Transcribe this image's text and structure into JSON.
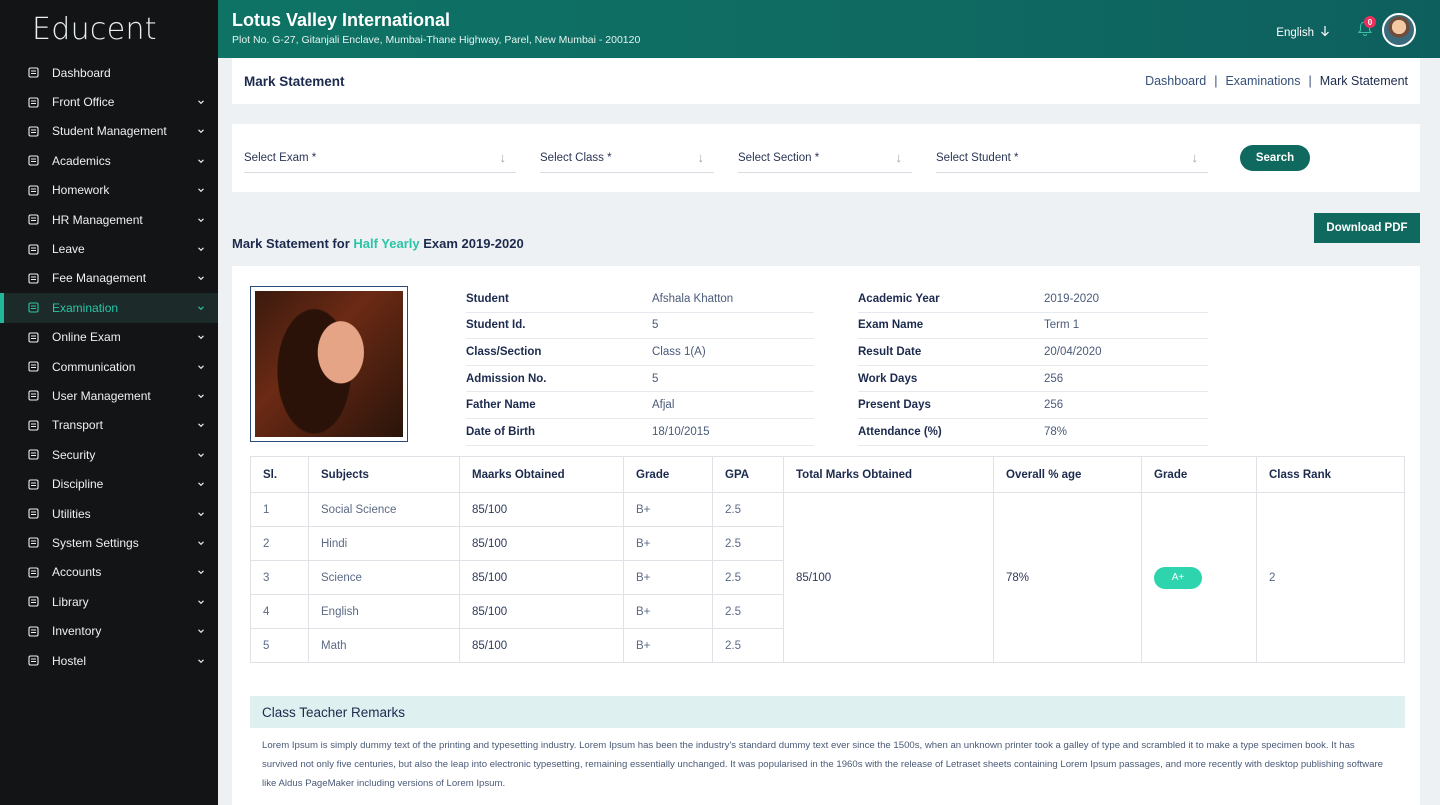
{
  "brand": "Educent",
  "sidebar": {
    "items": [
      {
        "label": "Dashboard",
        "icon": "dashboard-icon",
        "chevron": false,
        "active": false
      },
      {
        "label": "Front Office",
        "icon": "front-office-icon",
        "chevron": true,
        "active": false
      },
      {
        "label": "Student Management",
        "icon": "student-icon",
        "chevron": true,
        "active": false
      },
      {
        "label": "Academics",
        "icon": "academics-icon",
        "chevron": true,
        "active": false
      },
      {
        "label": "Homework",
        "icon": "homework-icon",
        "chevron": true,
        "active": false
      },
      {
        "label": "HR Management",
        "icon": "hr-icon",
        "chevron": true,
        "active": false
      },
      {
        "label": "Leave",
        "icon": "leave-icon",
        "chevron": true,
        "active": false
      },
      {
        "label": "Fee Management",
        "icon": "fee-icon",
        "chevron": true,
        "active": false
      },
      {
        "label": "Examination",
        "icon": "examination-icon",
        "chevron": true,
        "active": true
      },
      {
        "label": "Online Exam",
        "icon": "online-exam-icon",
        "chevron": true,
        "active": false
      },
      {
        "label": "Communication",
        "icon": "communication-icon",
        "chevron": true,
        "active": false
      },
      {
        "label": "User Management",
        "icon": "user-management-icon",
        "chevron": true,
        "active": false
      },
      {
        "label": "Transport",
        "icon": "transport-icon",
        "chevron": true,
        "active": false
      },
      {
        "label": "Security",
        "icon": "security-icon",
        "chevron": true,
        "active": false
      },
      {
        "label": "Discipline",
        "icon": "discipline-icon",
        "chevron": true,
        "active": false
      },
      {
        "label": "Utilities",
        "icon": "utilities-icon",
        "chevron": true,
        "active": false
      },
      {
        "label": "System Settings",
        "icon": "settings-icon",
        "chevron": true,
        "active": false
      },
      {
        "label": "Accounts",
        "icon": "accounts-icon",
        "chevron": true,
        "active": false
      },
      {
        "label": "Library",
        "icon": "library-icon",
        "chevron": true,
        "active": false
      },
      {
        "label": "Inventory",
        "icon": "inventory-icon",
        "chevron": true,
        "active": false
      },
      {
        "label": "Hostel",
        "icon": "hostel-icon",
        "chevron": true,
        "active": false
      }
    ]
  },
  "header": {
    "school_name": "Lotus Valley International",
    "school_address": "Plot No. G-27, Gitanjali Enclave, Mumbai-Thane Highway, Parel, New Mumbai - 200120",
    "language": "English",
    "notification_count": "0"
  },
  "page": {
    "title": "Mark Statement",
    "breadcrumb": [
      "Dashboard",
      "Examinations",
      "Mark Statement"
    ],
    "breadcrumb_sep": "|"
  },
  "filters": {
    "exam": "Select Exam *",
    "class": "Select Class *",
    "section": "Select Section *",
    "student": "Select Student *",
    "search_label": "Search"
  },
  "statement": {
    "heading_prefix": "Mark Statement for ",
    "heading_exam": "Half Yearly",
    "heading_suffix": " Exam 2019-2020",
    "download_label": "Download PDF"
  },
  "student_info": {
    "left": [
      {
        "label": "Student",
        "value": "Afshala Khatton"
      },
      {
        "label": "Student Id.",
        "value": "5"
      },
      {
        "label": "Class/Section",
        "value": "Class 1(A)"
      },
      {
        "label": "Admission No.",
        "value": "5"
      },
      {
        "label": "Father Name",
        "value": "Afjal"
      },
      {
        "label": "Date of Birth",
        "value": "18/10/2015"
      }
    ],
    "right": [
      {
        "label": "Academic Year",
        "value": "2019-2020"
      },
      {
        "label": "Exam Name",
        "value": "Term 1"
      },
      {
        "label": "Result Date",
        "value": "20/04/2020"
      },
      {
        "label": "Work Days",
        "value": "256"
      },
      {
        "label": "Present Days",
        "value": "256"
      },
      {
        "label": "Attendance (%)",
        "value": "78%"
      }
    ]
  },
  "marks_table": {
    "headers": [
      "Sl.",
      "Subjects",
      "Maarks Obtained",
      "Grade",
      "GPA",
      "Total Marks Obtained",
      "Overall % age",
      "Grade",
      "Class Rank"
    ],
    "rows": [
      [
        "1",
        "Social Science",
        "85/100",
        "B+",
        "2.5"
      ],
      [
        "2",
        "Hindi",
        "85/100",
        "B+",
        "2.5"
      ],
      [
        "3",
        "Science",
        "85/100",
        "B+",
        "2.5"
      ],
      [
        "4",
        "English",
        "85/100",
        "B+",
        "2.5"
      ],
      [
        "5",
        "Math",
        "85/100",
        "B+",
        "2.5"
      ]
    ],
    "total_marks": "85/100",
    "overall_percent": "78%",
    "overall_grade": "A+",
    "class_rank": "2"
  },
  "remarks": {
    "title": "Class Teacher Remarks",
    "text": "Lorem Ipsum is simply dummy text of the printing and typesetting industry. Lorem Ipsum has been the industry's standard dummy text ever since the 1500s, when an unknown printer took a galley of type and scrambled it to make a type specimen book. It has survived not only five centuries, but also the leap into electronic typesetting, remaining essentially unchanged. It was popularised in the 1960s with the release of Letraset sheets containing Lorem Ipsum passages, and more recently with desktop publishing software like Aldus PageMaker including versions of Lorem Ipsum."
  },
  "colors": {
    "accent": "#10695f",
    "highlight": "#29c5a6",
    "sidebar_bg": "#121416",
    "badge": "#e8315b"
  }
}
